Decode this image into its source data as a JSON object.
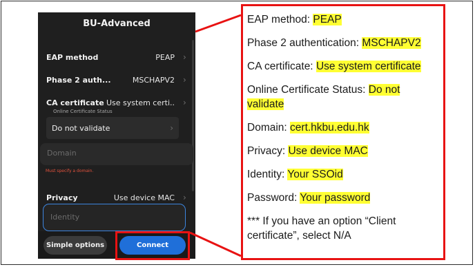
{
  "phone": {
    "title": "BU-Advanced",
    "rows": [
      {
        "label": "EAP method",
        "value": "PEAP"
      },
      {
        "label": "Phase 2 auth...",
        "value": "MSCHAPV2"
      },
      {
        "label": "CA certificate",
        "value": "Use system certi.."
      }
    ],
    "ocsp": {
      "label": "Online Certificate Status",
      "value": "Do not validate"
    },
    "domain": {
      "placeholder": "Domain",
      "error": "Must specify a domain."
    },
    "privacy": {
      "label": "Privacy",
      "value": "Use device MAC"
    },
    "identity": {
      "placeholder": "Identity"
    },
    "buttons": {
      "simple": "Simple options",
      "connect": "Connect"
    },
    "colors": {
      "background": "#1f1f1f",
      "accent": "#1f6fd9",
      "error": "#e5533d"
    }
  },
  "panel": {
    "items": [
      {
        "label": "EAP method: ",
        "value": "PEAP"
      },
      {
        "label": "Phase 2 authentication: ",
        "value": "MSCHAPV2"
      },
      {
        "label": "CA certificate: ",
        "value": "Use system certificate"
      },
      {
        "label": "Online Certificate Status: ",
        "value": "Do not validate"
      },
      {
        "label": "Domain: ",
        "value": "cert.hkbu.edu.hk"
      },
      {
        "label": "Privacy: ",
        "value": "Use device MAC"
      },
      {
        "label": "Identity: ",
        "value": "Your SSOid"
      },
      {
        "label": "Password: ",
        "value": "Your password"
      }
    ],
    "note": "*** If you have an option “Client certificate”, select N/A",
    "colors": {
      "highlight": "#ffff33",
      "border": "#e81212"
    }
  }
}
